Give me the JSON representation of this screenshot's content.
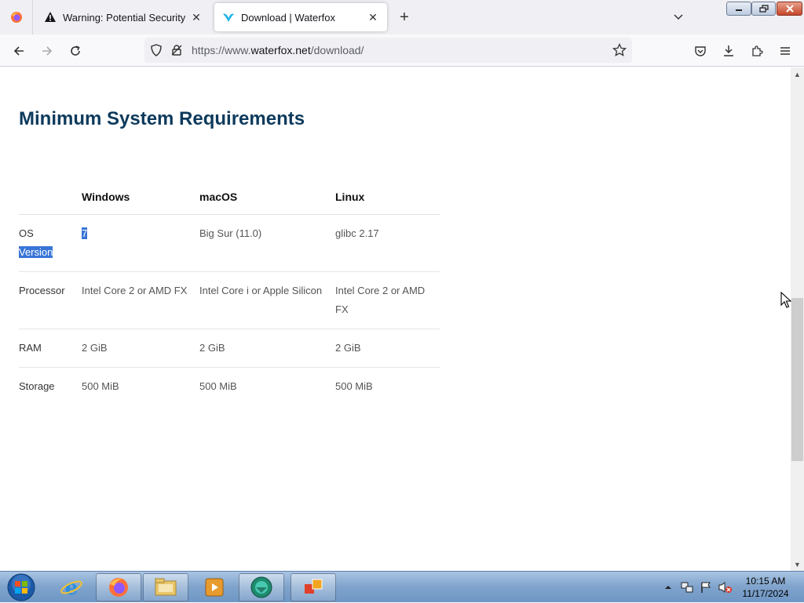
{
  "browser": {
    "tabs": [
      {
        "title": "Warning: Potential Security Risk Ahead",
        "icon": "warning-icon",
        "active": false
      },
      {
        "title": "Download | Waterfox",
        "icon": "waterfox-icon",
        "active": true
      }
    ],
    "url": {
      "prefix": "https://www.",
      "host": "waterfox.net",
      "path": "/download/"
    }
  },
  "page": {
    "heading": "Minimum System Requirements",
    "table": {
      "columns": [
        "",
        "Windows",
        "macOS",
        "Linux"
      ],
      "rows": [
        {
          "label_part1": "OS",
          "label_part2": "Version",
          "windows": "7",
          "macos": "Big Sur (11.0)",
          "linux": "glibc 2.17"
        },
        {
          "label": "Processor",
          "windows": "Intel Core 2 or AMD FX",
          "macos": "Intel Core i or Apple Silicon",
          "linux": "Intel Core 2 or AMD FX"
        },
        {
          "label": "RAM",
          "windows": "2 GiB",
          "macos": "2 GiB",
          "linux": "2 GiB"
        },
        {
          "label": "Storage",
          "windows": "500 MiB",
          "macos": "500 MiB",
          "linux": "500 MiB"
        }
      ]
    }
  },
  "taskbar": {
    "clock_time": "10:15 AM",
    "clock_date": "11/17/2024"
  },
  "colors": {
    "heading": "#0d3a5c",
    "selection": "#3875d6"
  }
}
